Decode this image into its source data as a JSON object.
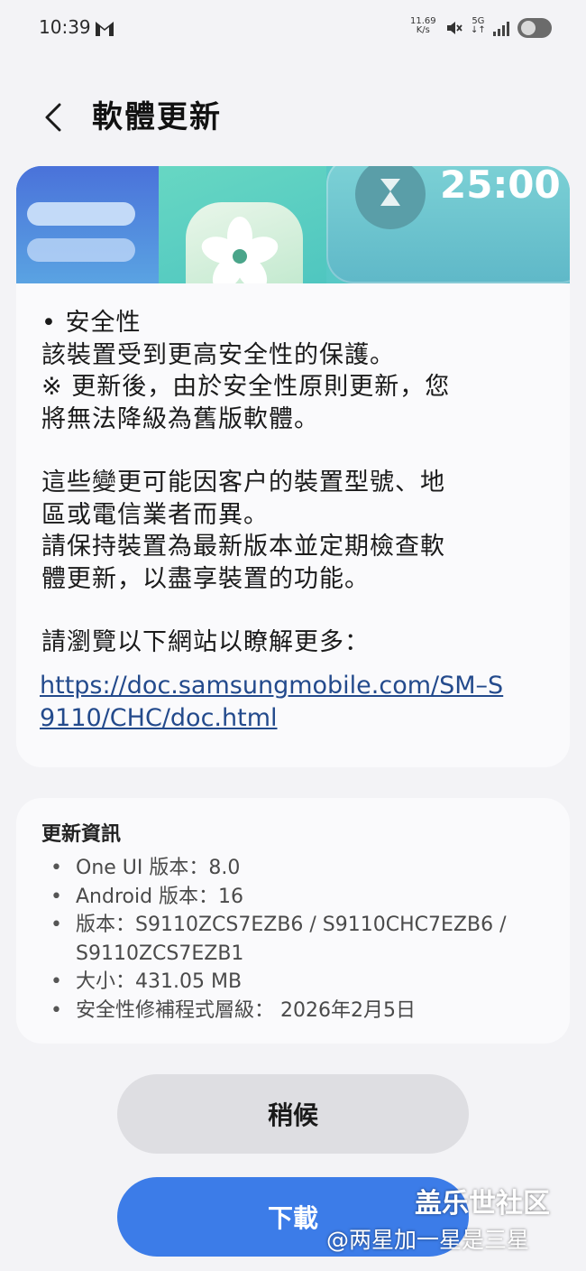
{
  "status_bar": {
    "time": "10:39",
    "net_speed_value": "11.69",
    "net_speed_unit": "K/s",
    "network_type": "5G",
    "icons": [
      "gmail-icon",
      "mute-icon",
      "signal-icon",
      "battery-toggle-icon"
    ]
  },
  "header": {
    "title": "軟體更新"
  },
  "banner": {
    "timer_text": "25:00"
  },
  "main": {
    "security_heading": "• 安全性",
    "security_line": "該裝置受到更高安全性的保護。",
    "note_line_1": "※ 更新後，由於安全性原則更新，您",
    "note_line_2": "將無法降級為舊版軟體。",
    "variance_line_1": "這些變更可能因客户的裝置型號、地",
    "variance_line_2": "區或電信業者而異。",
    "keep_updated_line_1": "請保持裝置為最新版本並定期檢查軟",
    "keep_updated_line_2": "體更新，以盡享裝置的功能。",
    "learn_more": "請瀏覽以下網站以瞭解更多：",
    "link_text": "https://doc.samsungmobile.com/SM–S9110/CHC/doc.html"
  },
  "update_info": {
    "title": "更新資訊",
    "items": [
      "One UI 版本：8.0",
      "Android 版本：16",
      "版本：S9110ZCS7EZB6 / S9110CHC7EZB6 / S9110ZCS7EZB1",
      "大小：431.05 MB",
      "安全性修補程式層級： 2026年2月5日"
    ]
  },
  "buttons": {
    "later_label": "稍候",
    "download_label": "下載"
  },
  "watermark": {
    "line1": "盖乐世社区",
    "line2": "@两星加一星是三星"
  },
  "colors": {
    "accent": "#3c7ce8",
    "background": "#f3f3f6",
    "card": "#fafafc",
    "link": "#234a8c"
  }
}
